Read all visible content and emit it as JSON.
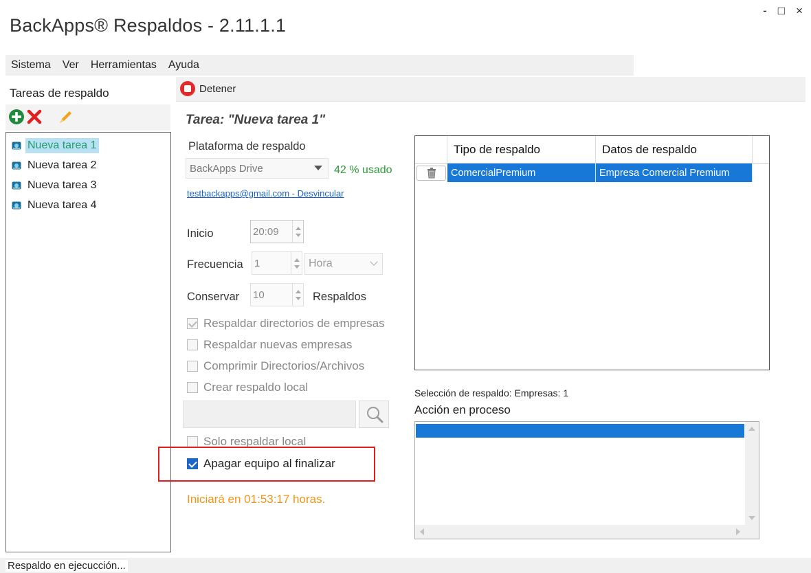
{
  "window": {
    "title": "BackApps® Respaldos - 2.11.1.1",
    "controls": {
      "minimize": "-",
      "maximize": "□",
      "close": "×"
    }
  },
  "menu": [
    "Sistema",
    "Ver",
    "Herramientas",
    "Ayuda"
  ],
  "sidebar": {
    "title": "Tareas de respaldo",
    "toolbar": {
      "add_icon": "plus-circle-icon",
      "delete_icon": "red-x-icon",
      "edit_icon": "pencil-icon"
    },
    "tasks": [
      {
        "label": "Nueva tarea 1",
        "selected": true
      },
      {
        "label": "Nueva tarea 2",
        "selected": false
      },
      {
        "label": "Nueva tarea 3",
        "selected": false
      },
      {
        "label": "Nueva tarea 4",
        "selected": false
      }
    ]
  },
  "toolbar": {
    "stop_label": "Detener"
  },
  "task": {
    "heading": "Tarea: \"Nueva tarea 1\"",
    "platform_label": "Plataforma de respaldo",
    "platform_value": "BackApps Drive",
    "usage": "42 % usado",
    "account_link": "testbackapps@gmail.com - Desvincular",
    "start_label": "Inicio",
    "start_value": "20:09",
    "frequency_label": "Frecuencia",
    "frequency_value": "1",
    "frequency_unit": "Hora",
    "keep_label": "Conservar",
    "keep_value": "10",
    "keep_unit": "Respaldos",
    "checkboxes": [
      {
        "label": "Respaldar directorios de empresas",
        "checked": true,
        "enabled": false
      },
      {
        "label": "Respaldar nuevas empresas",
        "checked": false,
        "enabled": false
      },
      {
        "label": "Comprimir Directorios/Archivos",
        "checked": false,
        "enabled": false
      },
      {
        "label": "Crear respaldo local",
        "checked": false,
        "enabled": false
      }
    ],
    "local_path": "",
    "only_local": {
      "label": "Solo respaldar local",
      "checked": false,
      "enabled": false
    },
    "shutdown": {
      "label": "Apagar equipo al finalizar",
      "checked": true,
      "enabled": true
    },
    "countdown": "Iniciará en 01:53:17 horas."
  },
  "backup_table": {
    "columns": [
      "",
      "Tipo de respaldo",
      "Datos de respaldo"
    ],
    "rows": [
      {
        "type": "ComercialPremium",
        "data": "Empresa Comercial Premium"
      }
    ]
  },
  "selection_summary": "Selección de respaldo: Empresas: 1",
  "action_label": "Acción en proceso",
  "status": "Respaldo en ejecucción...",
  "colors": {
    "accent_blue": "#1878d8",
    "usage_green": "#2e9a3a",
    "countdown_orange": "#f29416",
    "highlight_red": "#e21b1b",
    "selected_task_bg": "#b9e1f4"
  }
}
